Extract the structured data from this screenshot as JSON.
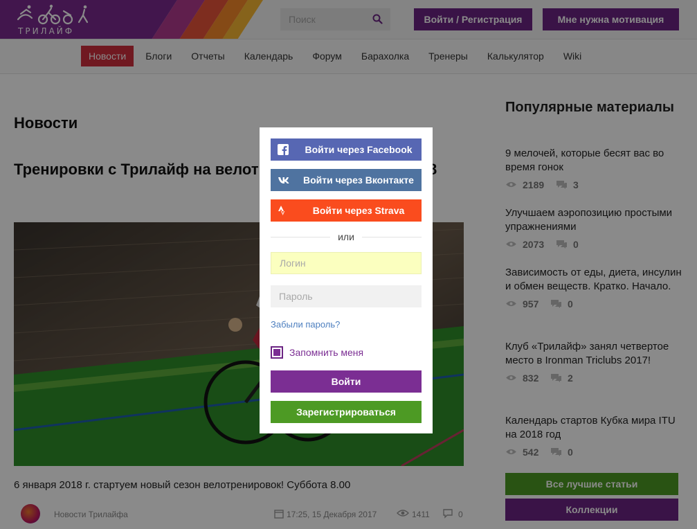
{
  "header": {
    "logo_text": "ТРИЛАЙФ",
    "search_placeholder": "Поиск",
    "login_button": "Войти / Регистрация",
    "motivation_button": "Мне нужна мотивация"
  },
  "nav": {
    "items": [
      "Новости",
      "Блоги",
      "Отчеты",
      "Календарь",
      "Форум",
      "Барахолка",
      "Тренеры",
      "Калькулятор",
      "Wiki"
    ],
    "active": "Новости"
  },
  "main": {
    "section_title": "Новости",
    "article_title": "Тренировки с Трилайф на велотреке: новый сезон 2018",
    "lead": "6 января 2018 г. стартуем новый сезон велотренировок! Суббота 8.00",
    "author": "Новости Трилайфа",
    "date": "17:25, 15 Декабря 2017",
    "views": "1411",
    "comments": "0"
  },
  "sidebar": {
    "title": "Популярные материалы",
    "items": [
      {
        "title": "9 мелочей, которые бесят вас во время гонок",
        "views": "2189",
        "comments": "3"
      },
      {
        "title": "Улучшаем аэропозицию простыми упражнениями",
        "views": "2073",
        "comments": "0"
      },
      {
        "title": "Зависимость от еды, диета, инсулин и обмен веществ. Кратко. Начало.",
        "views": "957",
        "comments": "0"
      },
      {
        "title": "Клуб «Трилайф» занял четвертое место в Ironman Triclubs 2017!",
        "views": "832",
        "comments": "2"
      },
      {
        "title": "Календарь стартов Кубка мира ITU на 2018 год",
        "views": "542",
        "comments": "0"
      }
    ],
    "best_button": "Все лучшие статьи",
    "collections_button": "Коллекции"
  },
  "modal": {
    "facebook": "Войти через Facebook",
    "vk": "Войти через Вконтакте",
    "strava": "Войти через Strava",
    "or": "или",
    "login_placeholder": "Логин",
    "password_placeholder": "Пароль",
    "forgot": "Забыли пароль?",
    "remember": "Запомнить меня",
    "remember_checked": true,
    "signin": "Войти",
    "register": "Зарегистрироваться"
  },
  "colors": {
    "purple": "#6b2483",
    "nav_active": "#cf2f3d",
    "green": "#4d9a24",
    "facebook": "#5767b3",
    "vk": "#4f73a0",
    "strava": "#fa4c1e",
    "link": "#4d7fbf"
  }
}
